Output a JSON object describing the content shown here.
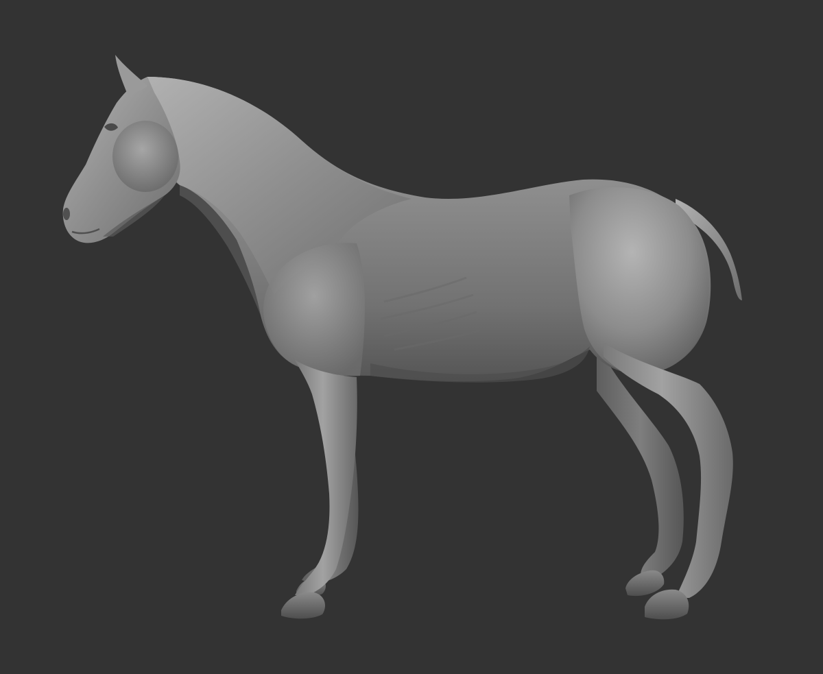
{
  "scene": {
    "background_color": "#333333",
    "subject": "horse-sculpt",
    "material_colors": {
      "base": "#8a8a8a",
      "highlight": "#b9b9b9",
      "mid": "#7c7c7c",
      "shadow": "#4a4a4a",
      "deep_shadow": "#3a3a3a"
    }
  }
}
